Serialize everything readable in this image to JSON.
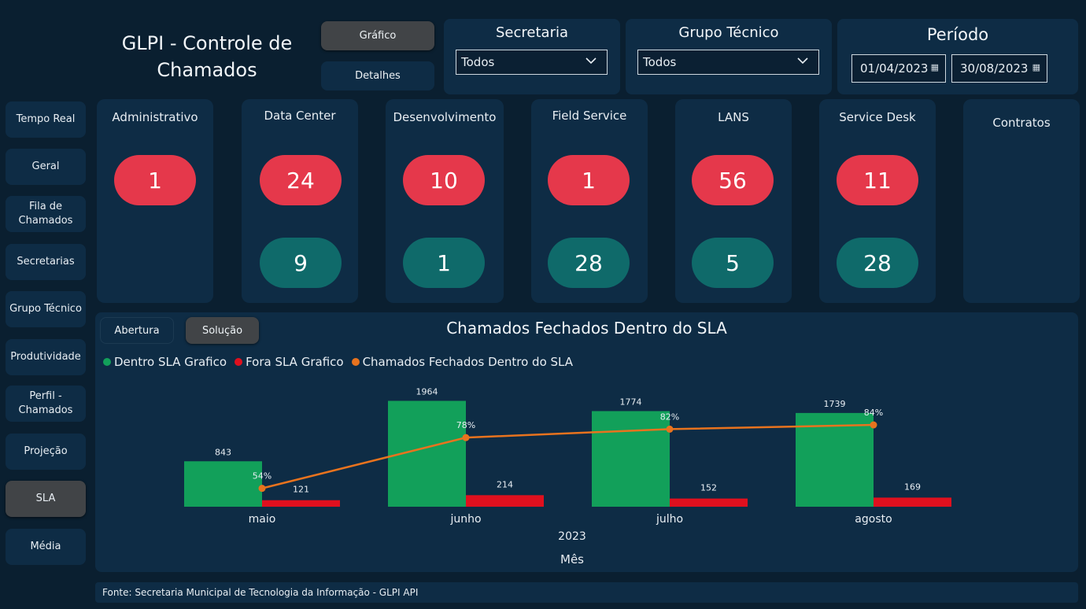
{
  "app_title": "GLPI - Controle de Chamados",
  "top_buttons": {
    "grafico": "Gráfico",
    "detalhes": "Detalhes"
  },
  "filters": {
    "secretaria": {
      "label": "Secretaria",
      "value": "Todos"
    },
    "grupo_tecnico": {
      "label": "Grupo Técnico",
      "value": "Todos"
    },
    "periodo": {
      "label": "Período",
      "start": "01/04/2023",
      "end": "30/08/2023"
    }
  },
  "sidebar": {
    "items": [
      {
        "label": "Tempo Real"
      },
      {
        "label": "Geral"
      },
      {
        "label": "Fila de Chamados"
      },
      {
        "label": "Secretarias"
      },
      {
        "label": "Grupo Técnico"
      },
      {
        "label": "Produtividade"
      },
      {
        "label": "Perfil - Chamados"
      },
      {
        "label": "Projeção"
      },
      {
        "label": "SLA"
      },
      {
        "label": "Média"
      }
    ],
    "active": "SLA"
  },
  "groups": [
    {
      "name": "Administrativo",
      "red": "1",
      "teal": ""
    },
    {
      "name": "Data Center",
      "red": "24",
      "teal": "9"
    },
    {
      "name": "Desenvolvimento",
      "red": "10",
      "teal": "1"
    },
    {
      "name": "Field Service",
      "red": "1",
      "teal": "28"
    },
    {
      "name": "LANS",
      "red": "56",
      "teal": "5"
    },
    {
      "name": "Service Desk",
      "red": "11",
      "teal": "28"
    },
    {
      "name": "Contratos",
      "red": "",
      "teal": ""
    }
  ],
  "chart_tabs": {
    "abertura": "Abertura",
    "solucao": "Solução"
  },
  "colors": {
    "green": "#12a05a",
    "red": "#e0101e",
    "orange": "#e8731e",
    "pill_red": "#e5384b",
    "pill_teal": "#0f6a6a"
  },
  "chart_data": {
    "type": "bar",
    "title": "Chamados Fechados Dentro do SLA",
    "categories": [
      "maio",
      "junho",
      "julho",
      "agosto"
    ],
    "series": [
      {
        "name": "Dentro SLA Grafico",
        "values": [
          843,
          1964,
          1774,
          1739
        ]
      },
      {
        "name": "Fora SLA Grafico",
        "values": [
          121,
          214,
          152,
          169
        ]
      },
      {
        "name": "Chamados Fechados Dentro do SLA",
        "values": [
          54,
          78,
          82,
          84
        ],
        "labels": [
          "54%",
          "78%",
          "82%",
          "84%"
        ]
      }
    ],
    "xlabel_year": "2023",
    "xlabel": "Mês",
    "ylim": [
      0,
      2000
    ]
  },
  "footer": "Fonte: Secretaria Municipal de Tecnologia da Informação - GLPI API"
}
